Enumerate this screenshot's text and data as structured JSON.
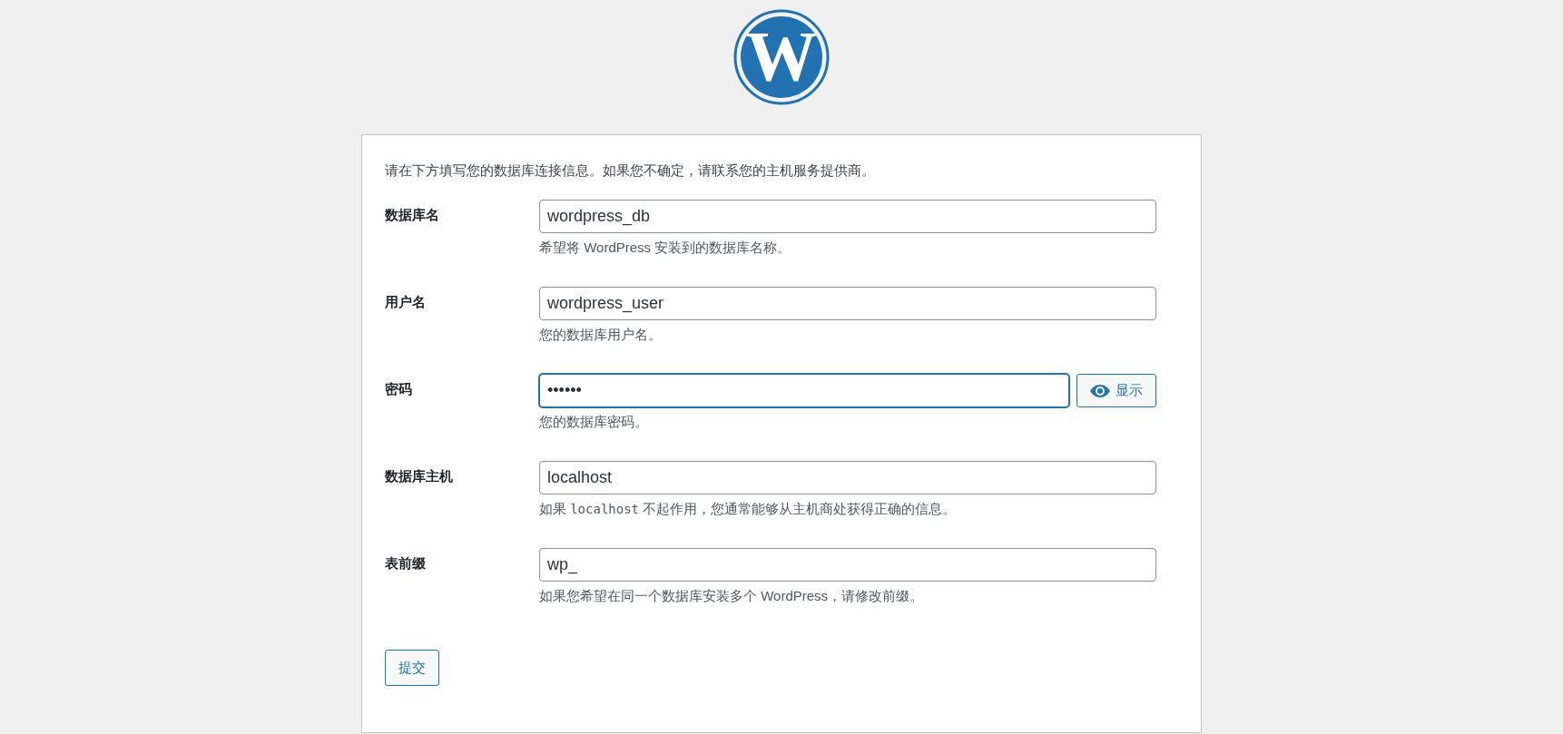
{
  "logo": {
    "letter": "W"
  },
  "intro": "请在下方填写您的数据库连接信息。如果您不确定，请联系您的主机服务提供商。",
  "fields": [
    {
      "kind": "text",
      "label": "数据库名",
      "value": "wordpress_db",
      "focused": false,
      "help": [
        {
          "kind": "plain",
          "text": "希望将 WordPress 安装到的数据库名称。"
        }
      ]
    },
    {
      "kind": "text",
      "label": "用户名",
      "value": "wordpress_user",
      "focused": false,
      "help": [
        {
          "kind": "plain",
          "text": "您的数据库用户名。"
        }
      ]
    },
    {
      "kind": "password",
      "label": "密码",
      "value": "••••••",
      "focused": true,
      "toggle": "显示",
      "help": [
        {
          "kind": "plain",
          "text": "您的数据库密码。"
        }
      ]
    },
    {
      "kind": "text",
      "label": "数据库主机",
      "value": "localhost",
      "focused": false,
      "help": [
        {
          "kind": "plain",
          "text": "如果 "
        },
        {
          "kind": "code",
          "text": "localhost"
        },
        {
          "kind": "plain",
          "text": " 不起作用，您通常能够从主机商处获得正确的信息。"
        }
      ]
    },
    {
      "kind": "text",
      "label": "表前缀",
      "value": "wp_",
      "focused": false,
      "help": [
        {
          "kind": "plain",
          "text": "如果您希望在同一个数据库安装多个 WordPress，请修改前缀。"
        }
      ]
    }
  ],
  "submit": "提交"
}
